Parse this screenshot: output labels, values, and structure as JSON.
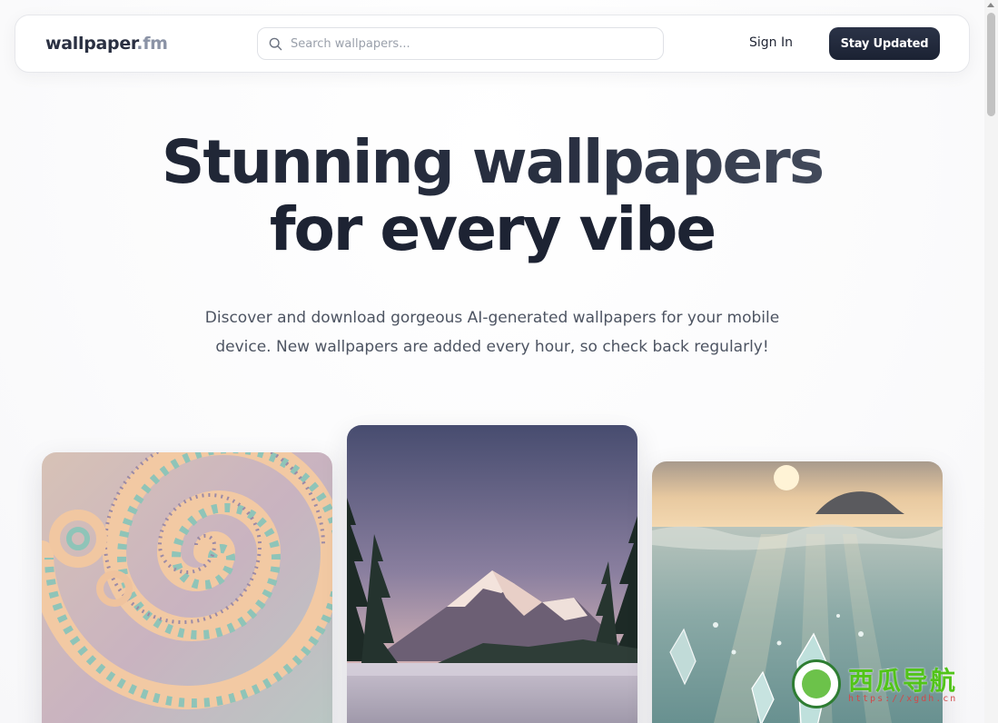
{
  "navbar": {
    "logo_main": "wallpaper",
    "logo_ext": ".fm",
    "search_placeholder": "Search wallpapers...",
    "signin_label": "Sign In",
    "cta_label": "Stay Updated"
  },
  "hero": {
    "title_line1": "Stunning wallpapers",
    "title_line2": "for every vibe",
    "subtitle": "Discover and download gorgeous AI-generated wallpapers for your mobile device. New wallpapers are added every hour, so check back regularly!"
  },
  "wallpapers": [
    {
      "subject": "pastel fractal spiral"
    },
    {
      "subject": "snowy mountain lake at sunset"
    },
    {
      "subject": "underwater crystals with sunset"
    }
  ],
  "watermark": {
    "text": "西瓜导航",
    "url": "https://xgdh.cn"
  },
  "colors": {
    "primary_button": "#1f2637",
    "text_dark": "#1d2333",
    "logo_muted": "#8b93a6"
  }
}
